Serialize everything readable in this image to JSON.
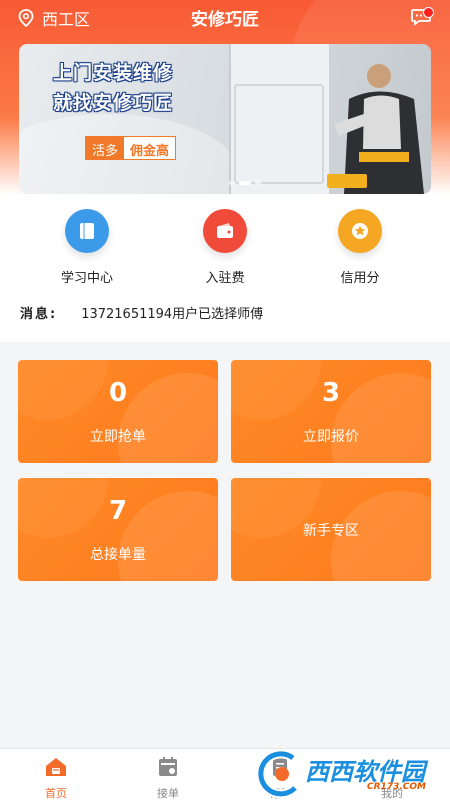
{
  "header": {
    "location": "西工区",
    "title": "安修巧匠"
  },
  "banner": {
    "line1": "上门安装维修",
    "line2": "就找安修巧匠",
    "tag1": "活多",
    "tag2": "佣金高"
  },
  "quick_menu": [
    {
      "label": "学习中心",
      "icon": "book-icon",
      "color": "#3b9be8"
    },
    {
      "label": "入驻费",
      "icon": "wallet-icon",
      "color": "#f04a3a"
    },
    {
      "label": "信用分",
      "icon": "star-icon",
      "color": "#f5a623"
    }
  ],
  "news": {
    "label": "消息:",
    "text": "13721651194用户已选择师傅"
  },
  "cards": [
    {
      "number": "0",
      "label": "立即抢单"
    },
    {
      "number": "3",
      "label": "立即报价"
    },
    {
      "number": "7",
      "label": "总接单量"
    },
    {
      "number": "",
      "label": "新手专区"
    }
  ],
  "tabs": [
    {
      "label": "首页",
      "icon": "home-icon",
      "active": true
    },
    {
      "label": "接单",
      "icon": "calendar-icon",
      "active": false
    },
    {
      "label": "订单",
      "icon": "order-icon",
      "active": false
    },
    {
      "label": "我的",
      "icon": "user-icon",
      "active": false
    }
  ],
  "watermark": {
    "text": "西西软件园",
    "sub": "CR173.COM"
  },
  "colors": {
    "brand": "#f36b2a",
    "card": "#ff8a27"
  }
}
